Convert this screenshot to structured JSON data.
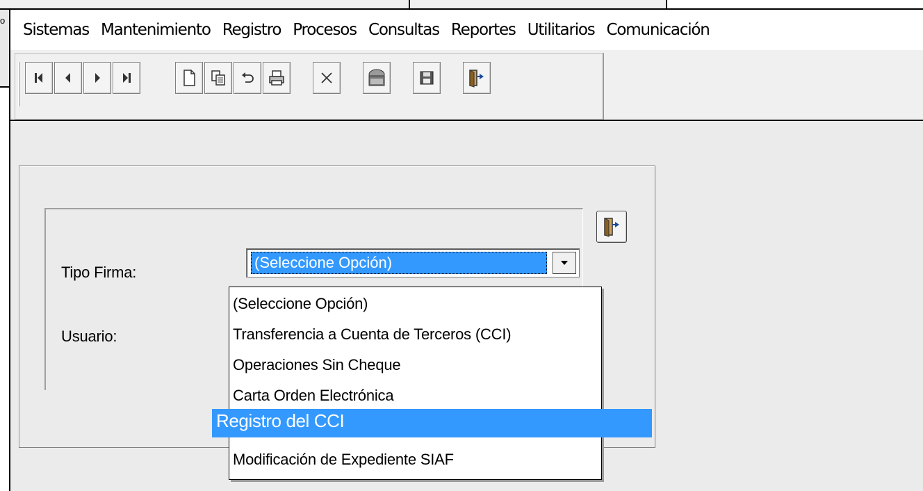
{
  "menu": {
    "items": [
      "Sistemas",
      "Mantenimiento",
      "Registro",
      "Procesos",
      "Consultas",
      "Reportes",
      "Utilitarios",
      "Comunicación"
    ]
  },
  "background_fragment_text": "o",
  "toolbar": {
    "icons": [
      "first-record-icon",
      "previous-record-icon",
      "next-record-icon",
      "last-record-icon",
      "new-document-icon",
      "copy-icon",
      "undo-icon",
      "print-icon",
      "delete-icon",
      "query-icon",
      "save-icon",
      "exit-door-icon"
    ]
  },
  "form": {
    "tipo_firma_label": "Tipo Firma:",
    "usuario_label": "Usuario:",
    "tipo_firma_selected": "(Seleccione Opción)"
  },
  "dropdown": {
    "options": [
      "(Seleccione Opción)",
      "Transferencia a Cuenta de Terceros (CCI)",
      "Operaciones Sin Cheque",
      "Carta Orden Electrónica",
      "Modificación de Expediente SIAF"
    ],
    "highlighted": "Registro del CCI"
  },
  "colors": {
    "selection_blue": "#3399ff",
    "window_bg": "#ebebeb"
  }
}
